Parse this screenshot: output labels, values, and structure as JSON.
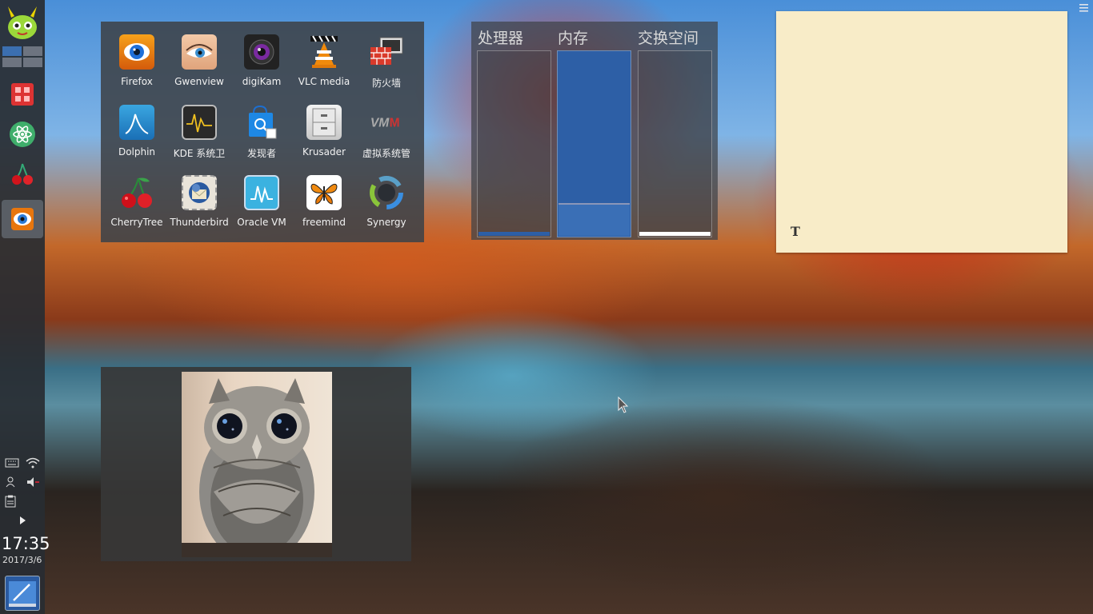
{
  "panel": {
    "logo_icon": "mascot-logo-icon",
    "pager_desktops": 4,
    "tasks": [
      {
        "name": "red-grid-app-icon"
      },
      {
        "name": "atom-app-icon"
      },
      {
        "name": "cherry-app-icon"
      },
      {
        "name": "firefox-task-icon"
      }
    ],
    "tray_icons": [
      "keyboard-icon",
      "wifi-icon",
      "user-icon",
      "volume-muted-icon",
      "clipboard-icon",
      "expand-arrow-icon"
    ],
    "clock": "17:35",
    "date": "2017/3/6",
    "bottom_app_icon": "text-editor-icon"
  },
  "apps": [
    {
      "label": "Firefox",
      "icon": "firefox-icon"
    },
    {
      "label": "Gwenview",
      "icon": "gwenview-icon"
    },
    {
      "label": "digiKam",
      "icon": "digikam-icon"
    },
    {
      "label": "VLC media",
      "icon": "vlc-icon"
    },
    {
      "label": "防火墙",
      "icon": "firewall-icon"
    },
    {
      "label": "Dolphin",
      "icon": "dolphin-icon"
    },
    {
      "label": "KDE 系统卫",
      "icon": "ksysguard-icon"
    },
    {
      "label": "发现者",
      "icon": "discover-icon"
    },
    {
      "label": "Krusader",
      "icon": "krusader-icon"
    },
    {
      "label": "虚拟系统管",
      "icon": "virt-manager-icon"
    },
    {
      "label": "CherryTree",
      "icon": "cherrytree-icon"
    },
    {
      "label": "Thunderbird",
      "icon": "thunderbird-icon"
    },
    {
      "label": "Oracle VM",
      "icon": "virtualbox-icon"
    },
    {
      "label": "freemind",
      "icon": "freemind-icon"
    },
    {
      "label": "Synergy",
      "icon": "synergy-icon"
    }
  ],
  "monitor": {
    "cpu_label": "处理器",
    "mem_label": "内存",
    "swap_label": "交换空间",
    "cpu_fraction": 0.02,
    "mem_fraction": 0.17,
    "swap_fraction": 0.02
  },
  "note": {
    "text": "",
    "format_icon": "text-format-icon",
    "format_symbol": "T"
  },
  "colors": {
    "accent": "#2d5fa6",
    "panel_bg": "#282c32",
    "note_bg": "#f8ecc8"
  }
}
